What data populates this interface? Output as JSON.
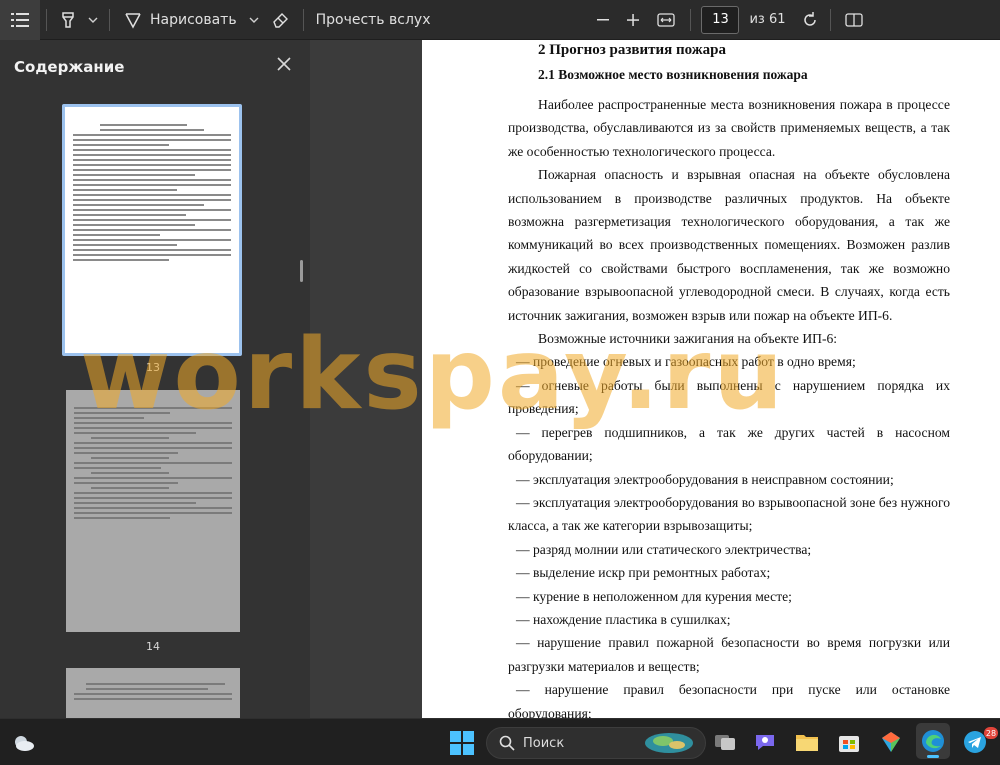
{
  "toolbar": {
    "draw_label": "Нарисовать",
    "read_aloud_label": "Прочесть вслух",
    "page_current": "13",
    "page_total": "из 61",
    "icons": [
      "list-icon",
      "highlighter-icon",
      "chevron-down-icon",
      "pen-icon",
      "eraser-icon",
      "minus-icon",
      "plus-icon",
      "fit-width-icon",
      "rotate-icon",
      "two-page-icon"
    ]
  },
  "sidebar": {
    "title": "Содержание",
    "thumbnails": [
      {
        "page_number": "13",
        "selected": true
      },
      {
        "page_number": "14",
        "selected": false
      }
    ]
  },
  "document": {
    "heading1": "2 Прогноз развития пожара",
    "heading2": "2.1 Возможное место возникновения пожара",
    "paragraphs": [
      "Наиболее распространенные места возникновения пожара в процессе производства, обуславливаются из за свойств применяемых веществ, а так же особенностью технологического процесса.",
      "Пожарная опасность и взрывная опасная на объекте обусловлена использованием в производстве различных продуктов. На объекте возможна разгерметизация технологического оборудования, а так же коммуникаций во всех производственных помещениях. Возможен разлив жидкостей со свойствами быстрого воспламенения, так же возможно образование взрывоопасной углеводородной смеси. В случаях, когда есть источник зажигания, возможен взрыв или пожар на объекте ИП-6.",
      "Возможные источники зажигания на объекте ИП-6:"
    ],
    "list_items": [
      "— проведение огневых и газоопасных работ в одно время;",
      "— огневые работы были выполнены с нарушением порядка их проведения;",
      "— перегрев подшипников, а так же других частей в насосном оборудовании;",
      "— эксплуатация электрооборудования в неисправном состоянии;",
      "— эксплуатация электрооборудования во взрывоопасной зоне без нужного класса, а так же категории взрывозащиты;",
      "— разряд молнии или статического электричества;",
      "— выделение искр при ремонтных работах;",
      "— курение в неположенном для курения месте;",
      "— нахождение пластика в сушилках;",
      "— нарушение правил пожарной безопасности во время погрузки или разгрузки материалов и веществ;",
      "— нарушение правил безопасности при пуске или остановке оборудования;"
    ]
  },
  "watermark": "workspay.ru",
  "taskbar": {
    "search_label": "Поиск",
    "telegram_badge": "28",
    "icons": [
      "weather-icon",
      "windows-start-icon",
      "search-icon",
      "widget-icon",
      "task-view-icon",
      "chat-icon",
      "file-explorer-icon",
      "store-icon",
      "photos-icon",
      "edge-icon",
      "telegram-icon"
    ]
  },
  "colors": {
    "accent": "#9cc2ee",
    "watermark": "#f0aa28"
  }
}
